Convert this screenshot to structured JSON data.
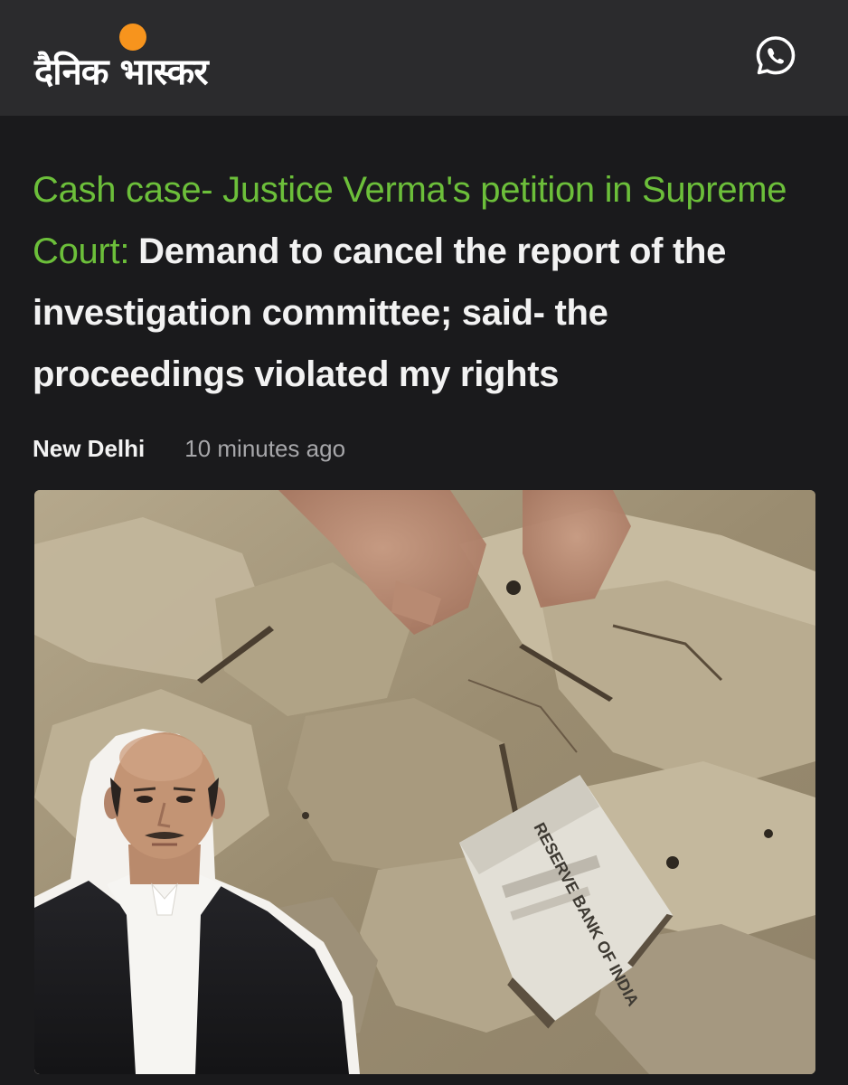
{
  "header": {
    "logo_text": "दैनिक भास्कर",
    "logo_sun_color": "#f7941d",
    "share_icon": "whatsapp-icon"
  },
  "article": {
    "kicker": "Cash case- Justice Verma's petition in Supreme Court:",
    "headline": "Demand to cancel the report of the investigation committee; said- the proceedings violated my rights",
    "location": "New Delhi",
    "time": "10 minutes ago",
    "kicker_color": "#6cbf3a",
    "image": {
      "banknote_text": "RESERVE BANK OF INDIA"
    }
  }
}
